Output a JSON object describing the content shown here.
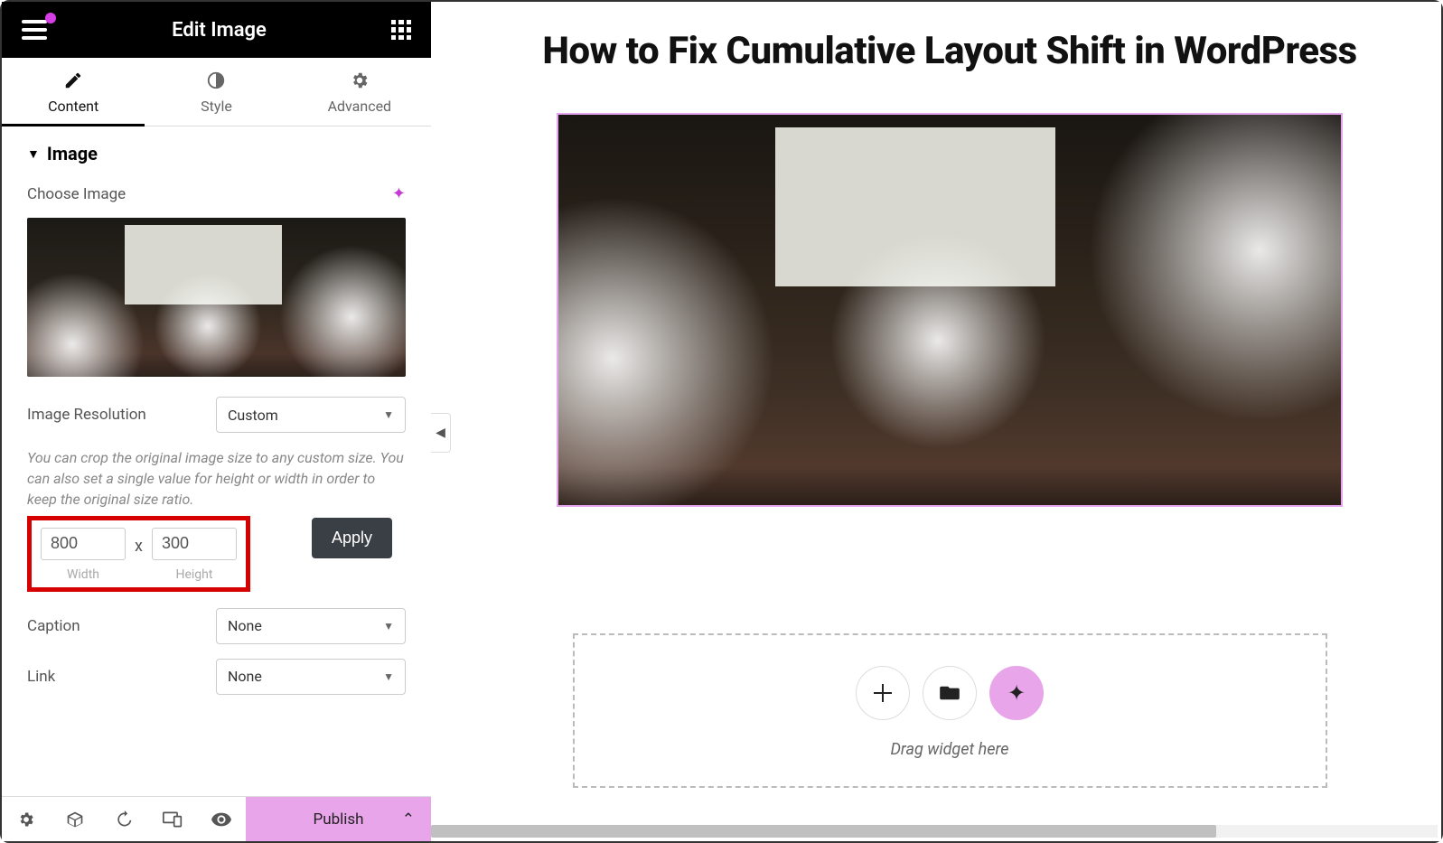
{
  "header": {
    "title": "Edit Image"
  },
  "tabs": {
    "content": "Content",
    "style": "Style",
    "advanced": "Advanced"
  },
  "section": {
    "title": "Image",
    "choose_label": "Choose Image",
    "resolution_label": "Image Resolution",
    "resolution_value": "Custom",
    "help": "You can crop the original image size to any custom size. You can also set a single value for height or width in order to keep the original size ratio.",
    "width_value": "800",
    "height_value": "300",
    "width_label": "Width",
    "height_label": "Height",
    "size_sep": "x",
    "apply_label": "Apply",
    "caption_label": "Caption",
    "caption_value": "None",
    "link_label": "Link",
    "link_value": "None"
  },
  "footer": {
    "publish": "Publish"
  },
  "canvas": {
    "heading": "How to Fix Cumulative Layout Shift in WordPress",
    "dropzone_text": "Drag widget here"
  }
}
